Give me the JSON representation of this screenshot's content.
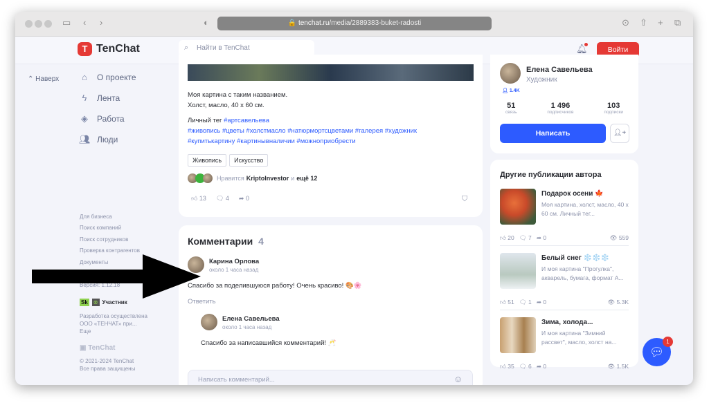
{
  "browser": {
    "url_host": "tenchat.ru",
    "url_path": "/media/2889383-buket-radosti"
  },
  "header": {
    "logo": "TenChat",
    "search_placeholder": "Найти в TenChat",
    "login": "Войти"
  },
  "sidebar": {
    "back_to_top": "Наверх",
    "nav": [
      {
        "label": "О проекте",
        "icon": "home-icon"
      },
      {
        "label": "Лента",
        "icon": "lightning-icon"
      },
      {
        "label": "Работа",
        "icon": "briefcase-icon"
      },
      {
        "label": "Люди",
        "icon": "people-icon"
      }
    ],
    "links": [
      "Для бизнеса",
      "Поиск компаний",
      "Поиск сотрудников",
      "Проверка контрагентов",
      "Документы"
    ],
    "version": "Версия: 1.12.18",
    "skolkovo_badge": "Sk",
    "participant": "Участник",
    "dev_note_1": "Разработка осуществлена",
    "dev_note_2": "ООО «ТЕНЧАТ» при...",
    "more": "Еще",
    "footer_logo": "TenChat",
    "copyright": "© 2021-2024 TenChat",
    "rights": "Все права защищены"
  },
  "post": {
    "line1": "Моя картина с таким названием.",
    "line2": "Холст, масло, 40 х 60 см.",
    "personal_tag_label": "Личный тег",
    "personal_tag": "#артсавельева",
    "hashtags_1": "#живопись #цветы #холстмасло #натюрмортсцветами #галерея #художник",
    "hashtags_2": "#купитькартину #картинывналичии #можноприобрести",
    "chips": [
      "Живопись",
      "Искусство"
    ],
    "likes_prefix": "Нравится",
    "liked_by": "KriptoInvestor",
    "likes_and": "и",
    "likes_more": "ещё 12",
    "like_count": "13",
    "comment_count": "4",
    "share_count": "0"
  },
  "comments": {
    "title": "Комментарии",
    "count": "4",
    "items": [
      {
        "author": "Карина Орлова",
        "time": "около 1 часа назад",
        "text": "Спасибо за поделившуюся работу! Очень красиво! 🎨🌸",
        "reply": "Ответить"
      },
      {
        "author": "Елена Савельева",
        "time": "около 1 часа назад",
        "text": "Спасибо за написавшийся комментарий! 🥂"
      }
    ],
    "input_placeholder": "Написать комментарий..."
  },
  "profile": {
    "name": "Елена Савельева",
    "role": "Художник",
    "followers_badge": "1.4K",
    "stats": [
      {
        "value": "51",
        "label": "связь"
      },
      {
        "value": "1 496",
        "label": "подписчиков"
      },
      {
        "value": "103",
        "label": "подписки"
      }
    ],
    "write": "Написать"
  },
  "publications": {
    "title": "Другие публикации автора",
    "items": [
      {
        "title": "Подарок осени 🍁",
        "desc": "Моя картина, холст, масло, 40 х 60 см. Личный тег...",
        "likes": "20",
        "comments": "7",
        "shares": "0",
        "views": "559"
      },
      {
        "title": "Белый снег ❄️❄️❄️",
        "desc": "И моя картина \"Прогулка\", акварель, бумага, формат А...",
        "likes": "51",
        "comments": "1",
        "shares": "0",
        "views": "5.3K"
      },
      {
        "title": "Зима, холода...",
        "desc": "И моя картина \"Зимний рассвет\", масло, холст на...",
        "likes": "35",
        "comments": "6",
        "shares": "0",
        "views": "1.5K"
      }
    ]
  },
  "chat": {
    "badge": "1"
  },
  "colors": {
    "brand_red": "#e53935",
    "accent_blue": "#2d5bff",
    "page_bg": "#f3f4fa"
  }
}
